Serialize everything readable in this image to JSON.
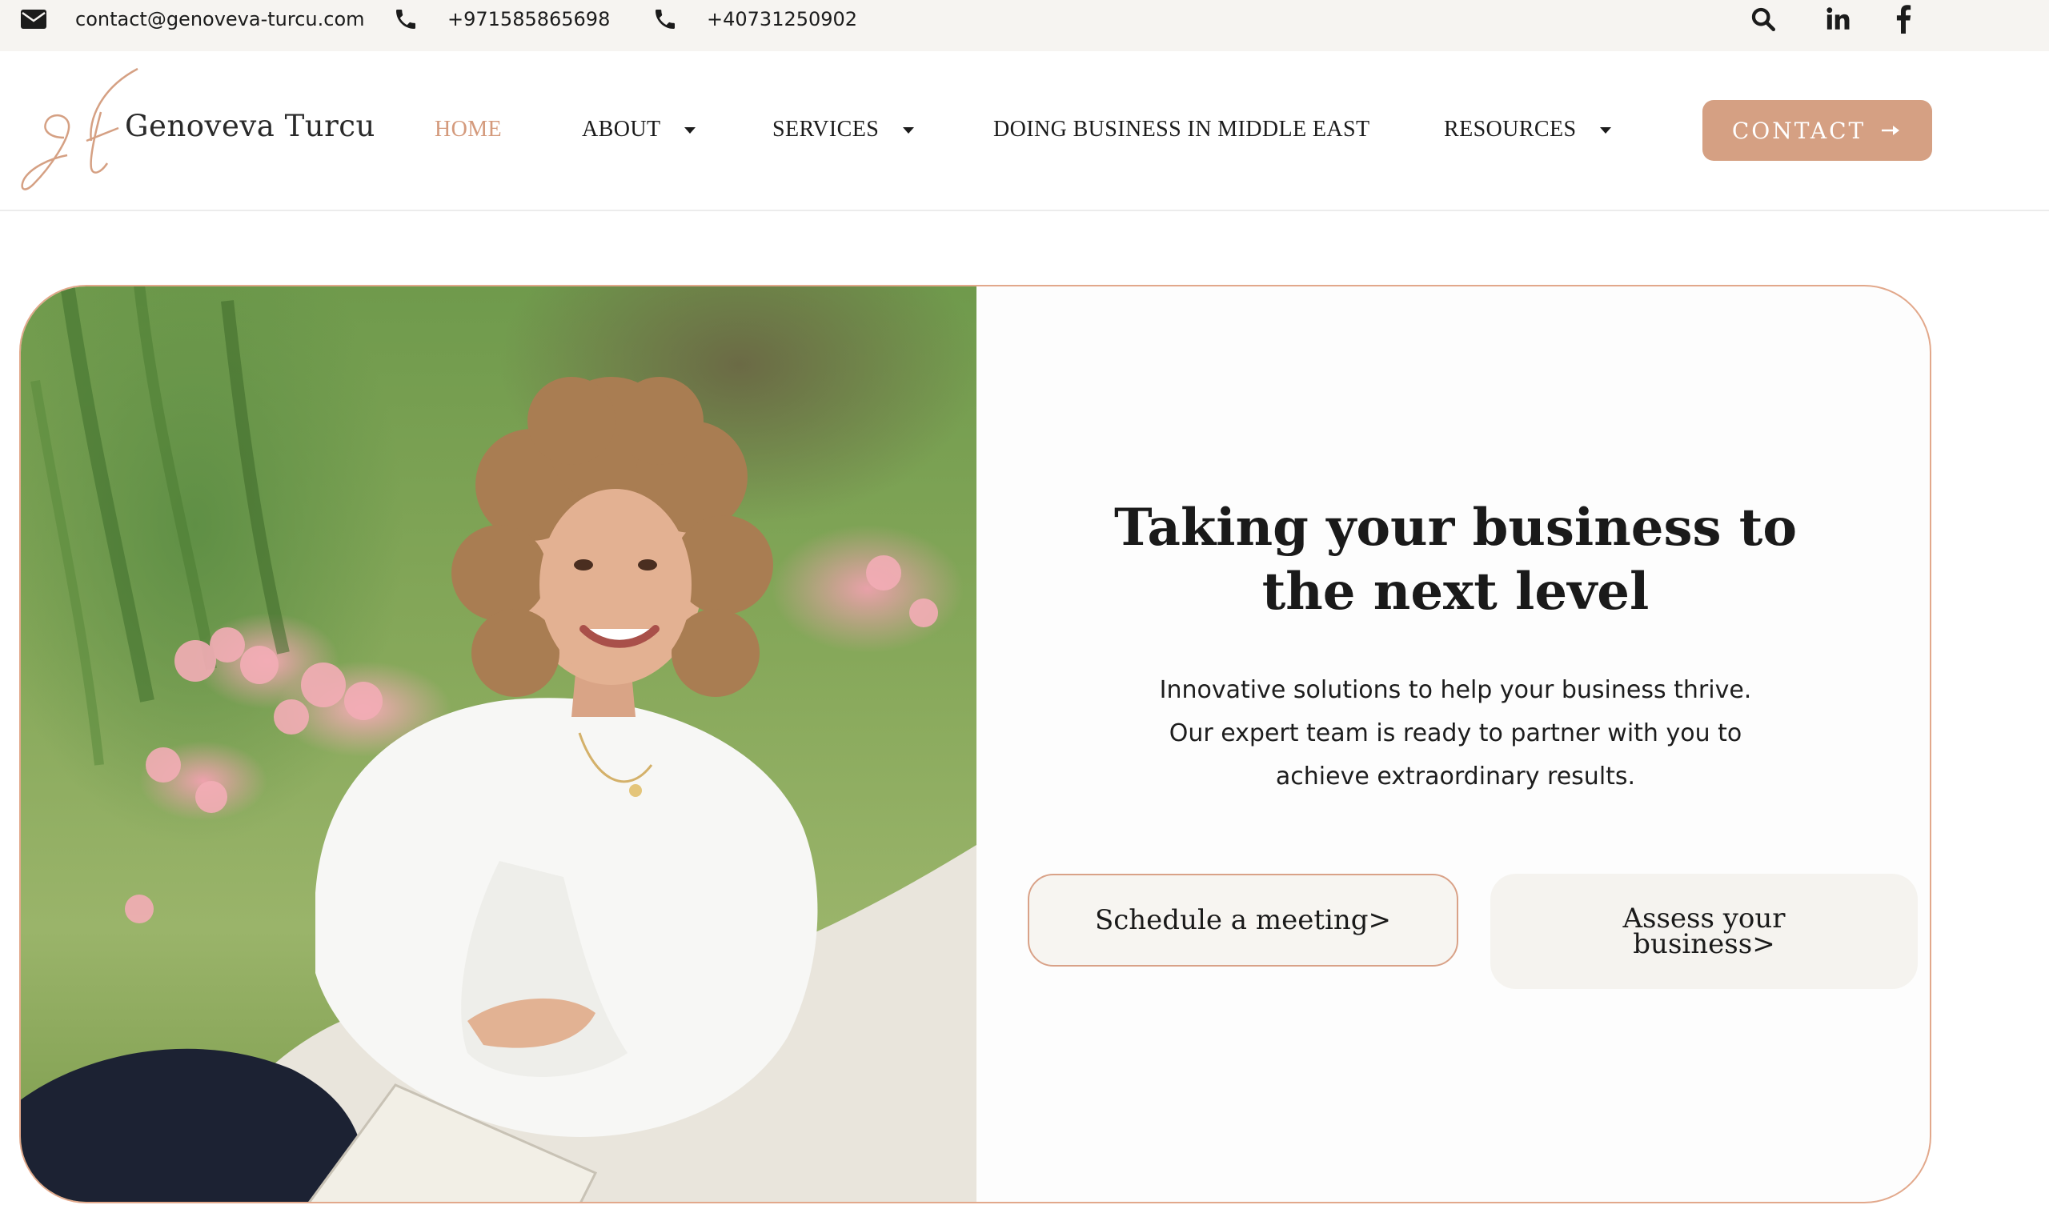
{
  "topbar": {
    "email": "contact@genoveva-turcu.com",
    "phone1": "+971585865698",
    "phone2": "+40731250902",
    "icons": [
      "envelope-icon",
      "phone-icon",
      "phone-icon",
      "search-icon",
      "linkedin-icon",
      "facebook-icon"
    ]
  },
  "header": {
    "logo_monogram": "gt",
    "logo_name": "Genoveva Turcu",
    "nav": [
      {
        "label": "HOME",
        "active": true,
        "dropdown": false
      },
      {
        "label": "ABOUT",
        "active": false,
        "dropdown": true
      },
      {
        "label": "SERVICES",
        "active": false,
        "dropdown": true
      },
      {
        "label": "DOING BUSINESS IN MIDDLE EAST",
        "active": false,
        "dropdown": false
      },
      {
        "label": "RESOURCES",
        "active": false,
        "dropdown": true
      }
    ],
    "cta_label": "CONTACT",
    "cta_icon": "arrow-right-icon"
  },
  "hero": {
    "title_line1": "Taking your business to",
    "title_line2": "the next level",
    "subtitle_line1": "Innovative solutions to help your business thrive.",
    "subtitle_line2": "Our expert team is ready to partner with you to",
    "subtitle_line3": "achieve extraordinary results.",
    "button_schedule": "Schedule a meeting>",
    "button_assess": "Assess your business>"
  },
  "colors": {
    "accent": "#d5a083",
    "nav_active": "#d49a7c",
    "topbar_bg": "#f6f4f1",
    "text": "#1c1c1c",
    "card_border": "#e2a88b"
  }
}
